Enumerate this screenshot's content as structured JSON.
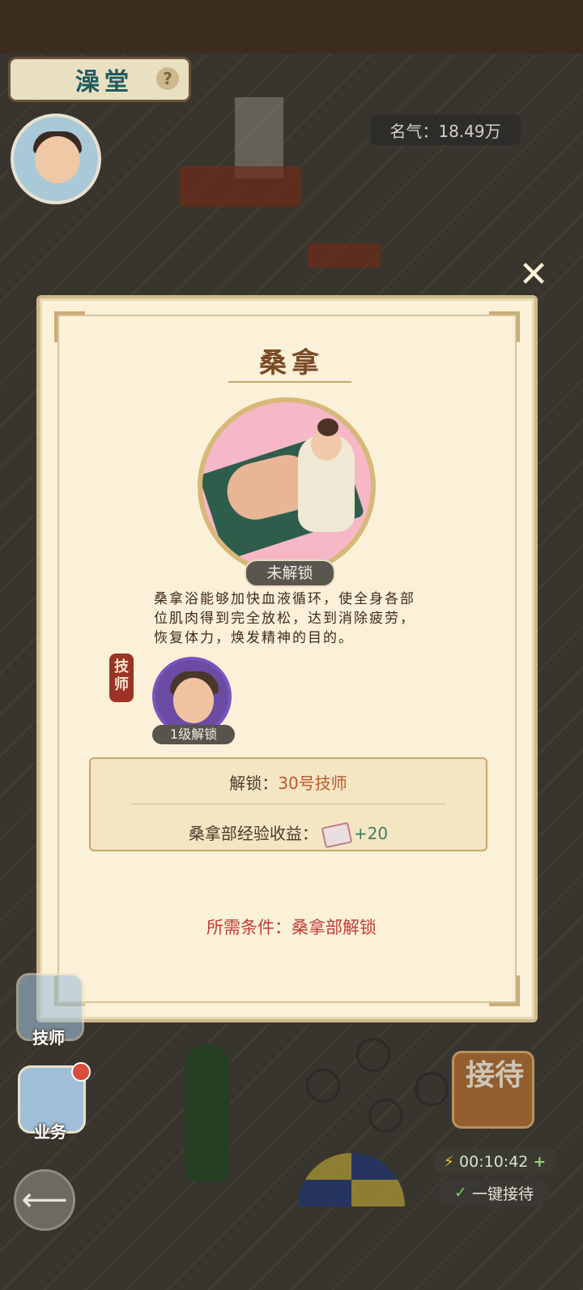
{
  "header": {
    "location_title": "澡堂",
    "help_icon": "question-icon",
    "fame_label": "名气：18.49万"
  },
  "modal": {
    "close_icon": "close-icon",
    "dept_name": "桑拿",
    "status_tag": "未解锁",
    "description": "桑拿浴能够加快血液循环，使全身各部位肌肉得到完全放松，达到消除疲劳，恢复体力，焕发精神的目的。",
    "technician_seal": "技师",
    "technician_level": "1级解锁",
    "unlock_label": "解锁：",
    "unlock_value": "30号技师",
    "exp_label": "桑拿部经验收益：",
    "exp_icon": "ticket-icon",
    "exp_value": "+20",
    "requirement": "所需条件：桑拿部解锁"
  },
  "side_menu": {
    "technician_label": "技师",
    "business_label": "业务"
  },
  "bottom_controls": {
    "reception_label": "接待",
    "timer": "00:10:42",
    "timer_icon": "lightning-icon",
    "timer_plus": "+",
    "auto_reception": "一键接待",
    "back_icon": "back-arrow-icon"
  },
  "colors": {
    "panel_bg": "#fbf1d8",
    "accent_brown": "#7a4a27",
    "requirement_red": "#c13d35",
    "exp_green": "#3a7d64",
    "unlock_orange": "#c0582c"
  }
}
